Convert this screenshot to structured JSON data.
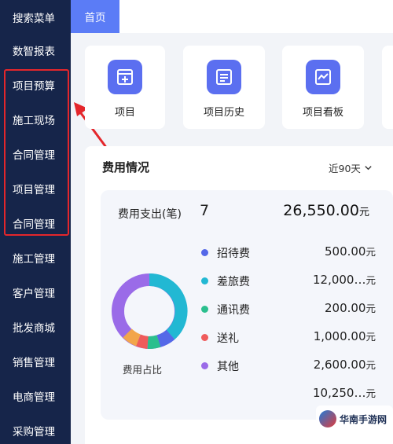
{
  "sidebar": {
    "items": [
      {
        "label": "搜索菜单"
      },
      {
        "label": "数智报表"
      },
      {
        "label": "项目预算"
      },
      {
        "label": "施工现场"
      },
      {
        "label": "合同管理"
      },
      {
        "label": "项目管理"
      },
      {
        "label": "合同管理"
      },
      {
        "label": "施工管理"
      },
      {
        "label": "客户管理"
      },
      {
        "label": "批发商城"
      },
      {
        "label": "销售管理"
      },
      {
        "label": "电商管理"
      },
      {
        "label": "采购管理"
      }
    ]
  },
  "topbar": {
    "home_tab": "首页"
  },
  "quick": [
    {
      "label": "项目",
      "icon": "add-document-icon"
    },
    {
      "label": "项目历史",
      "icon": "list-document-icon"
    },
    {
      "label": "项目看板",
      "icon": "chart-board-icon"
    }
  ],
  "expense": {
    "title": "费用情况",
    "range": "近90天",
    "summary_label": "费用支出(笔)",
    "summary_count": "7",
    "summary_total": "26,550.00",
    "currency": "元",
    "chart_caption": "费用占比",
    "rows": [
      {
        "name": "招待费",
        "amount": "500.00",
        "unit": "元"
      },
      {
        "name": "差旅费",
        "amount": "12,000…",
        "unit": "元"
      },
      {
        "name": "通讯费",
        "amount": "200.00",
        "unit": "元"
      },
      {
        "name": "送礼",
        "amount": "1,000.00",
        "unit": "元"
      },
      {
        "name": "其他",
        "amount": "2,600.00",
        "unit": "元"
      },
      {
        "name": "",
        "amount": "10,250…",
        "unit": "元"
      }
    ]
  },
  "colors": {
    "sidebar_bg": "#16254a",
    "accent": "#5b7cf6",
    "highlight": "#e4262b",
    "cat_zhaodai": "#5468e8",
    "cat_chailv": "#22b8d3",
    "cat_tongxun": "#2bbf8e",
    "cat_songli": "#ef5b5b",
    "cat_qita": "#9a6be8",
    "cat_other_orange": "#f2a54a"
  },
  "watermark": {
    "text": "华南手游网"
  }
}
